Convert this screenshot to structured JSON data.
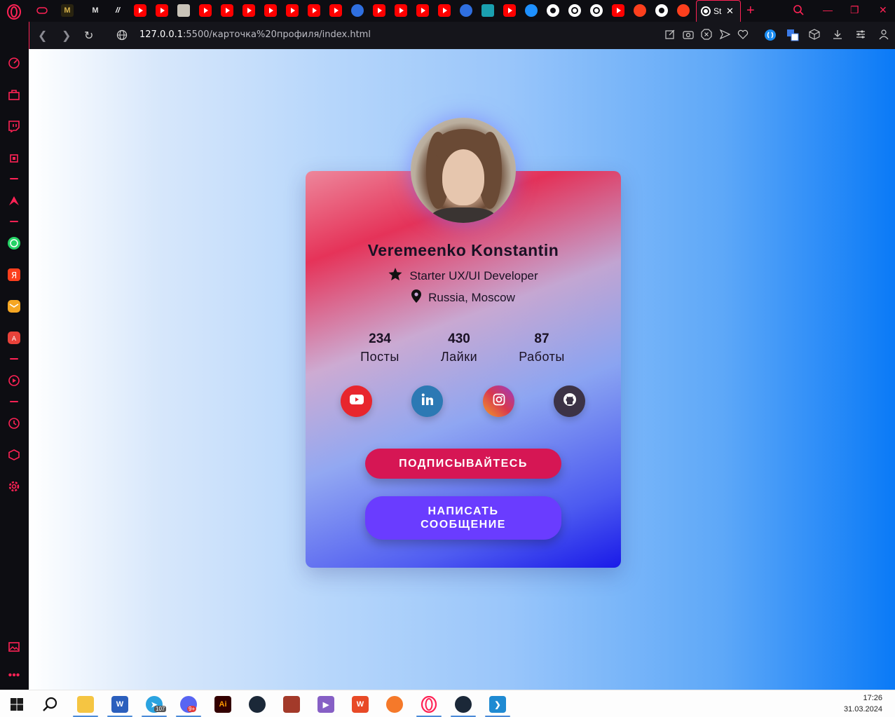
{
  "browser": {
    "active_tab_title": "St",
    "url_host": "127.0.0.1",
    "url_rest": ":5500/карточка%20профиля/index.html"
  },
  "profile": {
    "name": "Veremeenko Konstantin",
    "role": "Starter UX/UI Developer",
    "location": "Russia, Moscow",
    "stats": [
      {
        "value": "234",
        "label": "Посты"
      },
      {
        "value": "430",
        "label": "Лайки"
      },
      {
        "value": "87",
        "label": "Работы"
      }
    ],
    "social": [
      {
        "name": "youtube-icon",
        "color": "#e8262d"
      },
      {
        "name": "linkedin-icon",
        "color": "#2c79b4"
      },
      {
        "name": "instagram-icon",
        "color": "#d8384f"
      },
      {
        "name": "github-icon",
        "color": "#3c3346"
      }
    ],
    "subscribe_label": "ПОДПИСЫВАЙТЕСЬ",
    "message_label_1": "НАПИСАТЬ",
    "message_label_2": "СООБЩЕНИЕ"
  },
  "taskbar": {
    "time": "17:26",
    "date": "31.03.2024",
    "telegram_badge": "107",
    "discord_badge": "9+"
  },
  "colors": {
    "accent": "#ff2255",
    "subscribe_btn": "#d61654",
    "message_btn": "#6a3cff"
  }
}
